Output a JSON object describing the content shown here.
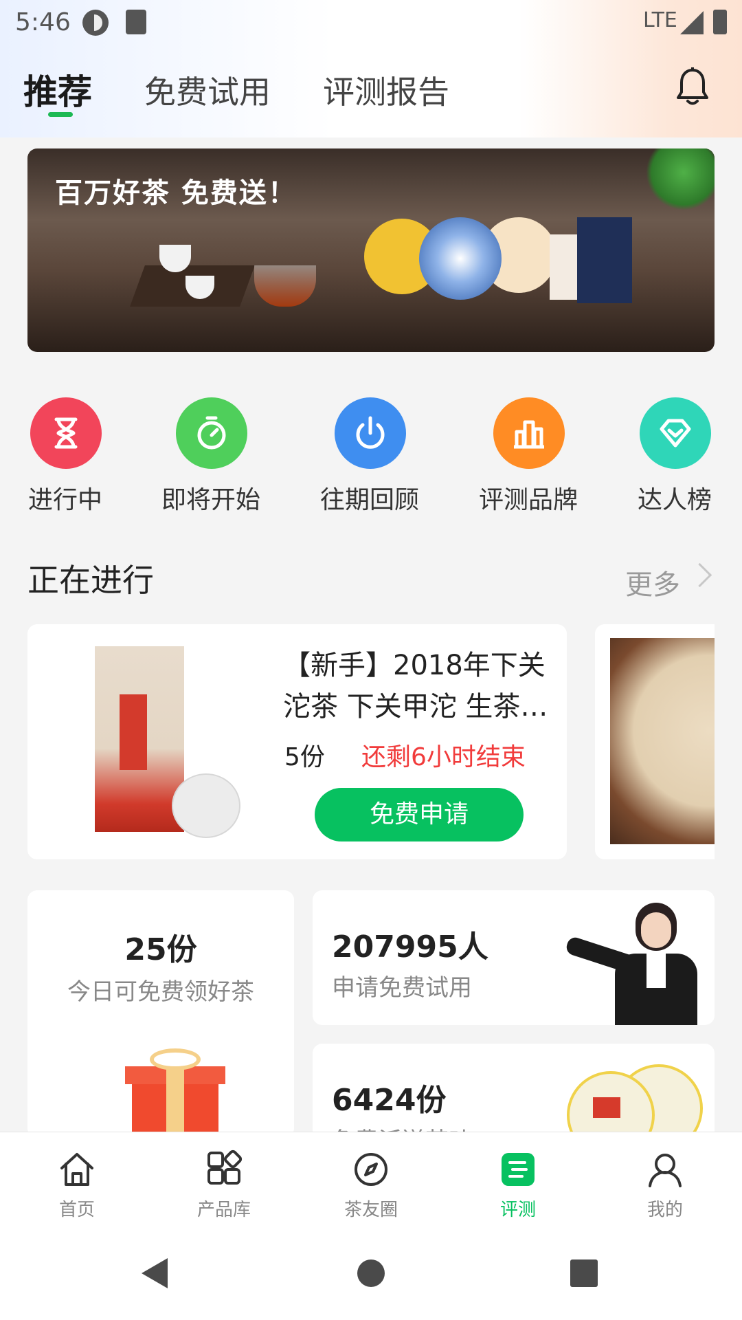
{
  "status_bar": {
    "time": "5:46",
    "network": "LTE"
  },
  "tabs": [
    {
      "label": "推荐"
    },
    {
      "label": "免费试用"
    },
    {
      "label": "评测报告"
    }
  ],
  "banner": {
    "title": "百万好茶 免费送！"
  },
  "shortcuts": [
    {
      "label": "进行中",
      "color": "#f2455a",
      "icon": "hourglass-icon"
    },
    {
      "label": "即将开始",
      "color": "#4fcf5b",
      "icon": "stopwatch-icon"
    },
    {
      "label": "往期回顾",
      "color": "#3f8ef0",
      "icon": "power-icon"
    },
    {
      "label": "评测品牌",
      "color": "#ff8c24",
      "icon": "buildings-icon"
    },
    {
      "label": "达人榜",
      "color": "#2fd6b8",
      "icon": "diamond-icon"
    }
  ],
  "section": {
    "title": "正在进行",
    "more": "更多"
  },
  "product": {
    "title": "【新手】2018年下关沱茶 下关甲沱 生茶…",
    "count": "5份",
    "remaining": "还剩6小时结束",
    "apply_label": "免费申请"
  },
  "stats": {
    "today": {
      "value": "25份",
      "label": "今日可免费领好茶"
    },
    "applicants": {
      "value": "207995人",
      "label": "申请免费试用"
    },
    "shipped": {
      "value": "6424份",
      "label": "免费派送茶叶"
    }
  },
  "bottom_nav": [
    {
      "label": "首页",
      "icon": "home-icon"
    },
    {
      "label": "产品库",
      "icon": "grid-icon"
    },
    {
      "label": "茶友圈",
      "icon": "compass-icon"
    },
    {
      "label": "评测",
      "icon": "review-icon",
      "active": true
    },
    {
      "label": "我的",
      "icon": "user-icon"
    }
  ],
  "colors": {
    "accent": "#07c160",
    "alert": "#f13b3b"
  }
}
